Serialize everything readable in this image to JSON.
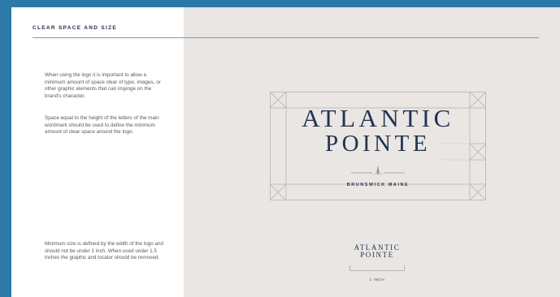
{
  "header": {
    "title": "CLEAR SPACE AND SIZE"
  },
  "body": {
    "paragraph_1": "When using the logo it is important to allow a minimum amount of space clear of type, images, or other graphic elements that can impinge on the brand's character.",
    "paragraph_2": "Space equal to the height of the letters of the main wordmark should be used to define the minimum amount of clear space around the logo.",
    "paragraph_3": "Minimum size is defined by the width of the logo and should not be under 1 inch. When used under 1.5 inches the graphic and locator should be removed."
  },
  "logo": {
    "line_1": "ATLANTIC",
    "line_2": "POINTE",
    "locator": "BRUNSWICK MAINE"
  },
  "min_size": {
    "line_1": "ATLANTIC",
    "line_2": "POINTE",
    "label": "1 INCH"
  },
  "colors": {
    "navy": "#233350",
    "page_bg": "#e9e6e3",
    "frame_blue": "#2a79a6",
    "guide_lines": "#c3bdb5"
  }
}
